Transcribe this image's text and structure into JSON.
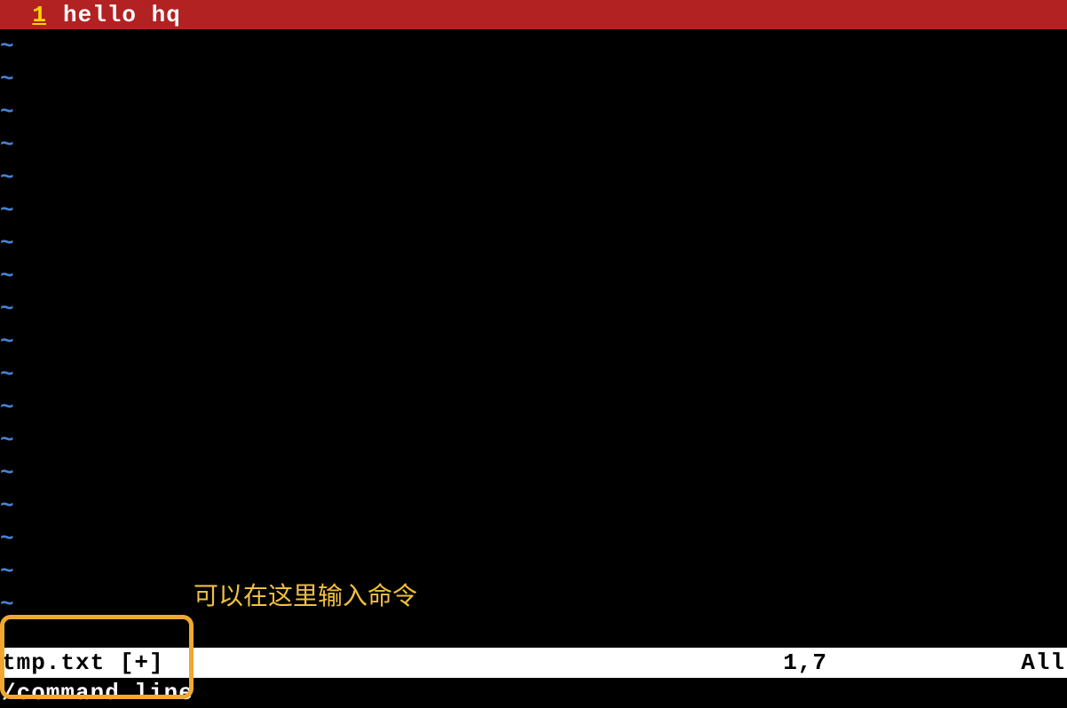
{
  "editor": {
    "line_number": "1",
    "content": "hello hq",
    "tilde": "~",
    "empty_line_count": 18
  },
  "annotation": {
    "text": "可以在这里输入命令"
  },
  "status_bar": {
    "filename": "tmp.txt [+]",
    "position": "1,7",
    "percent": "All"
  },
  "command_line": {
    "text": "/command line"
  }
}
